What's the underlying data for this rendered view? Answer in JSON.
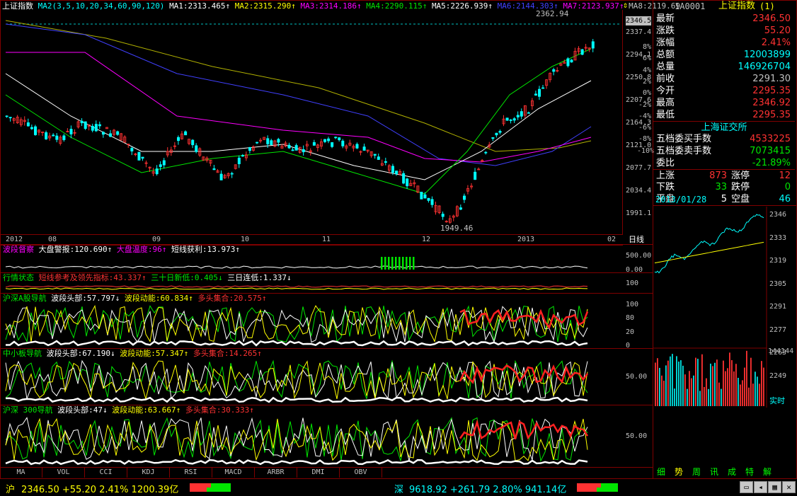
{
  "chart_title": "上证指数",
  "ma_header": {
    "ma2_params": "MA2(3,5,10,20,34,60,90,120)",
    "ma1": "MA1:2313.465↑",
    "ma2": "MA2:2315.290↑",
    "ma3": "MA3:2314.186↑",
    "ma4": "MA4:2290.115↑",
    "ma5": "MA5:2226.939↑",
    "ma6": "MA6:2144.303↑",
    "ma7": "MA7:2123.937↑",
    "ma8": "MA8:2119.69"
  },
  "price_axis": [
    "2346.5",
    "2337.4",
    "2294.1",
    "2250.8",
    "2207.6",
    "2164.3",
    "2121.0",
    "2077.7",
    "2034.4",
    "1991.1"
  ],
  "pct_axis": [
    "8%",
    "6%",
    "4%",
    "2%",
    "0%",
    "-2%",
    "-4%",
    "-6%",
    "-8%",
    "-10%"
  ],
  "hi_mark": "2362.94",
  "lo_mark": "1949.46",
  "date_axis": [
    "2012",
    "08",
    "09",
    "10",
    "11",
    "12",
    "2013",
    "02"
  ],
  "period_label": "日线",
  "ind1": {
    "name": "波段督察",
    "a": "大盘警报:120.690↑",
    "b": "大盘温度:96↑",
    "c": "短线获利:13.973↑",
    "axis": [
      "500.00",
      "0.00"
    ]
  },
  "ind2": {
    "name": "行情状态",
    "a": "短线参考及领先指标:43.337↑",
    "b": "三十日新低:0.405↓",
    "c": "三日连低:1.337↓",
    "axis": [
      "100"
    ]
  },
  "ind3": {
    "name": "沪深A股导航",
    "a": "波段头部:57.797↓",
    "b": "波段动能:60.834↑",
    "c": "多头集合:20.575↑",
    "axis": [
      "100",
      "80",
      "20",
      "0"
    ]
  },
  "ind4": {
    "name": "中小板导航",
    "a": "波段头部:67.190↓",
    "b": "波段动能:57.347↑",
    "c": "多头集合:14.265↑",
    "axis": [
      "50.00"
    ]
  },
  "ind5": {
    "name": "沪深 300导航",
    "a": "波段头部:47↓",
    "b": "波段动能:63.667↑",
    "c": "多头集合:30.333↑",
    "axis": [
      "50.00"
    ]
  },
  "bottom_tabs": [
    "MA",
    "VOL",
    "CCI",
    "KDJ",
    "RSI",
    "MACD",
    "ARBR",
    "DMI",
    "OBV"
  ],
  "quote": {
    "code": "1A0001",
    "name": "上证指数",
    "suffix": "(1)",
    "rows": [
      {
        "label": "最新",
        "value": "2346.50",
        "color": "#ff3232"
      },
      {
        "label": "涨跌",
        "value": "55.20",
        "color": "#ff3232"
      },
      {
        "label": "涨幅",
        "value": "2.41%",
        "color": "#ff3232"
      },
      {
        "label": "总额",
        "value": "12003899",
        "color": "#00ffff"
      },
      {
        "label": "总量",
        "value": "146926704",
        "color": "#00ffff"
      },
      {
        "label": "前收",
        "value": "2291.30",
        "color": "#c0c0c0"
      },
      {
        "label": "今开",
        "value": "2295.35",
        "color": "#ff3232"
      },
      {
        "label": "最高",
        "value": "2346.92",
        "color": "#ff3232"
      },
      {
        "label": "最低",
        "value": "2295.35",
        "color": "#ff3232"
      }
    ],
    "exchange": "上海证交所",
    "rows2": [
      {
        "label": "五档委买手数",
        "value": "4533225",
        "color": "#ff3232"
      },
      {
        "label": "五档委卖手数",
        "value": "7073415",
        "color": "#00e600"
      },
      {
        "label": "委比",
        "value": "-21.89%",
        "color": "#00e600"
      }
    ],
    "breadth": [
      {
        "l1": "上涨",
        "v1": "873",
        "c1": "#ff3232",
        "l2": "涨停",
        "v2": "12",
        "c2": "#ff3232"
      },
      {
        "l1": "下跌",
        "v1": "33",
        "c1": "#00e600",
        "l2": "跌停",
        "v2": "0",
        "c2": "#00e600"
      },
      {
        "l1": "平盘",
        "v1": "5",
        "c1": "#ffffff",
        "l2": "空盘",
        "v2": "46",
        "c2": "#00ffff"
      }
    ],
    "date": "2013/01/28",
    "mini_axis": [
      "2346",
      "2333",
      "2319",
      "2305",
      "2291",
      "2277",
      "2263",
      "2249"
    ],
    "vol_axis": "144144",
    "realtime_label": "实时"
  },
  "right_tabs": [
    "细",
    "势",
    "周",
    "讯",
    "成",
    "特",
    "解"
  ],
  "status": {
    "sh_label": "沪",
    "sh_text": "2346.50 +55.20 2.41% 1200.39亿",
    "sz_label": "深",
    "sz_text": "9618.92 +261.79 2.80% 941.14亿"
  }
}
